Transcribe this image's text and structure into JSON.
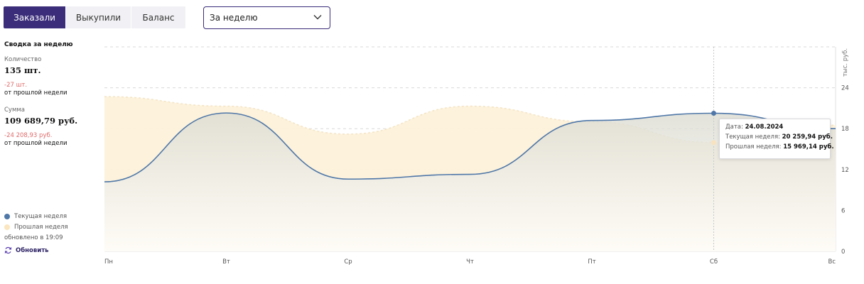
{
  "tabs": [
    {
      "label": "Заказали",
      "active": true
    },
    {
      "label": "Выкупили",
      "active": false
    },
    {
      "label": "Баланс",
      "active": false
    }
  ],
  "period_select": {
    "value": "За неделю",
    "icon": "chevron-down-icon"
  },
  "summary": {
    "heading": "Сводка за неделю",
    "quantity_label": "Количество",
    "quantity_value": "135 шт.",
    "quantity_delta": "-27 шт.",
    "quantity_since": "от прошлой недели",
    "sum_label": "Сумма",
    "sum_value": "109 689,79 руб.",
    "sum_delta": "-24 208,93 руб.",
    "sum_since": "от прошлой недели"
  },
  "legend": {
    "current": "Текущая неделя",
    "previous": "Прошлая неделя",
    "updated": "обновлено в 19:09"
  },
  "refresh_label": "Обновить",
  "tooltip": {
    "date_label": "Дата:",
    "date_value": "24.08.2024",
    "current_label": "Текущая неделя:",
    "current_value": "20 259,94 руб.",
    "previous_label": "Прошлая неделя:",
    "previous_value": "15 969,14 руб."
  },
  "colors": {
    "accent": "#3b2d7a",
    "current_series": "#4f77a8",
    "previous_series": "#fbe6bf",
    "negative_delta": "#e06a6a"
  },
  "chart_data": {
    "type": "area",
    "categories": [
      "Пн",
      "Вт",
      "Ср",
      "Чт",
      "Пт",
      "Сб",
      "Вс"
    ],
    "ylabel": "тыс. руб.",
    "ylim": [
      0,
      30
    ],
    "yticks": [
      0,
      6,
      12,
      18,
      24
    ],
    "grid": true,
    "series": [
      {
        "name": "Текущая неделя",
        "values": [
          10.2,
          20.3,
          10.6,
          11.3,
          19.2,
          20.26,
          18.0
        ]
      },
      {
        "name": "Прошлая неделя",
        "values": [
          22.7,
          21.3,
          17.2,
          21.3,
          19.0,
          15.97,
          18.5
        ]
      }
    ],
    "highlight_category": "Сб"
  }
}
